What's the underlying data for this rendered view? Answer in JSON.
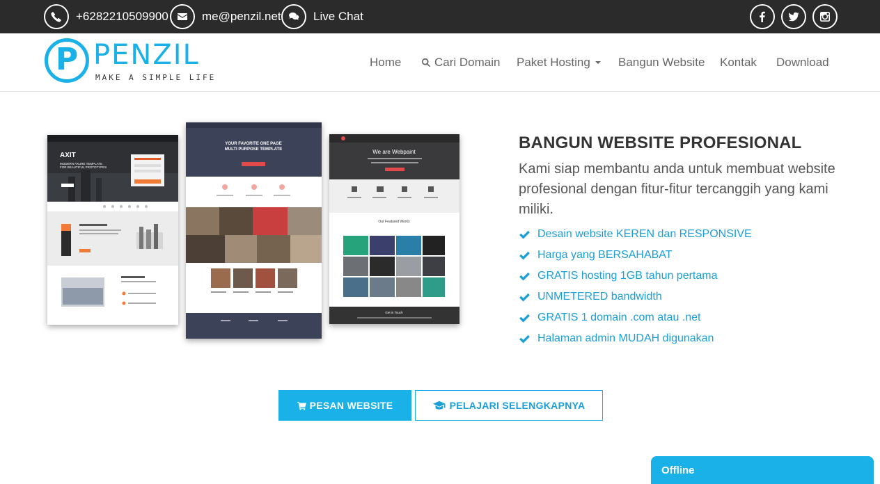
{
  "topbar": {
    "phone": "+6282210509900",
    "email": "me@penzil.net",
    "chat": "Live Chat",
    "social": [
      "facebook-icon",
      "twitter-icon",
      "instagram-icon"
    ]
  },
  "logo": {
    "letter": "P",
    "word": "PENZIL",
    "tagline": "MAKE A SIMPLE LIFE"
  },
  "nav": {
    "home": "Home",
    "domain": "Cari Domain",
    "hosting": "Paket Hosting",
    "build": "Bangun Website",
    "contact": "Kontak",
    "download": "Download"
  },
  "hero": {
    "title": "BANGUN WEBSITE PROFESIONAL",
    "lead": "Kami siap membantu anda untuk membuat website profesional dengan fitur-fitur tercanggih yang kami miliki.",
    "features": [
      "Desain website KEREN dan RESPONSIVE",
      "Harga yang BERSAHABAT",
      "GRATIS hosting 1GB tahun pertama",
      "UNMETERED bandwidth",
      "GRATIS 1 domain .com atau .net",
      "Halaman admin MUDAH digunakan"
    ]
  },
  "mockups": {
    "m1": {
      "brand": "AXIT",
      "headline": "MODERN AXURE TEMPLATE FOR BEAUTIFUL PROTOTYPES"
    },
    "m2": {
      "headline": "YOUR FAVORITE ONE PAGE MULTI PURPOSE TEMPLATE"
    },
    "m3": {
      "headline": "We are Webpaint",
      "works": "Our Featured Works",
      "footer": "Get in Touch"
    }
  },
  "buttons": {
    "order": "PESAN WEBSITE",
    "learn": "PELAJARI SELENGKAPNYA"
  },
  "chat": {
    "status": "Offline"
  },
  "colors": {
    "accent": "#1ab0e8",
    "topbar": "#2b2b2b",
    "text": "#333333"
  }
}
